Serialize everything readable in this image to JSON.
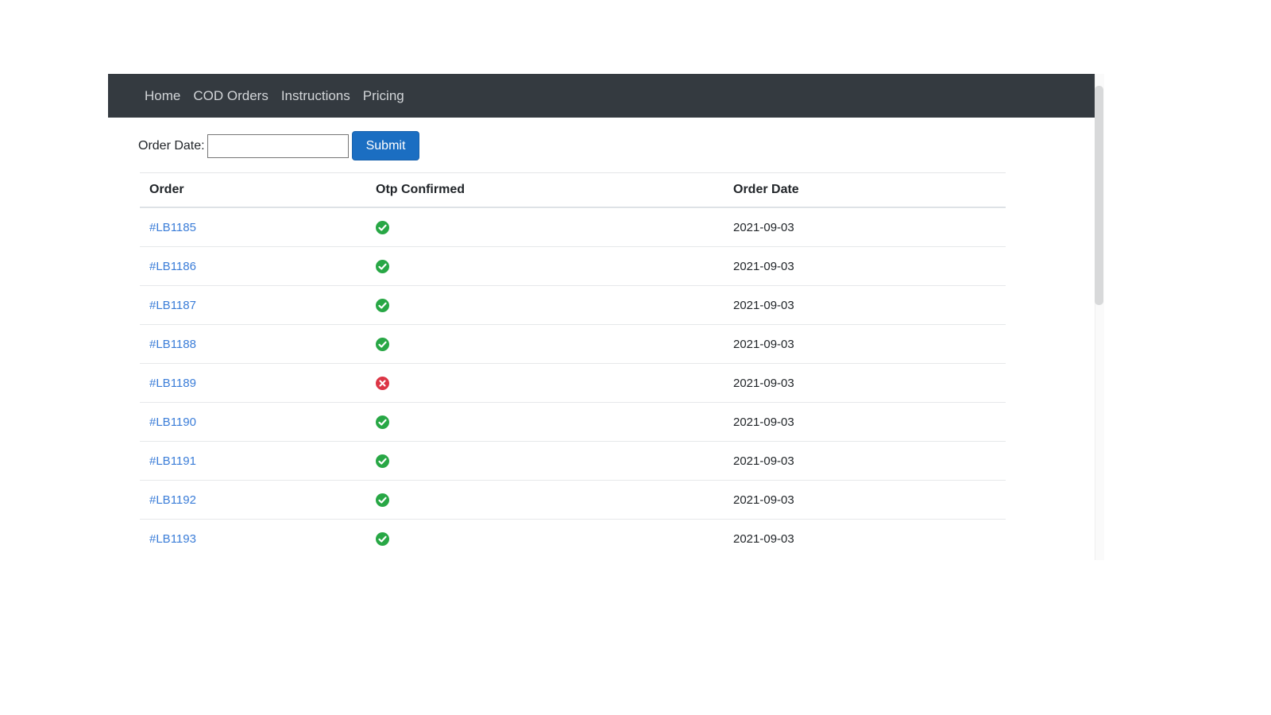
{
  "navbar": {
    "background_color": "#343a40",
    "items": [
      {
        "label": "Home",
        "name": "nav-link-home"
      },
      {
        "label": "COD Orders",
        "name": "nav-link-cod-orders"
      },
      {
        "label": "Instructions",
        "name": "nav-link-instructions"
      },
      {
        "label": "Pricing",
        "name": "nav-link-pricing"
      }
    ]
  },
  "form": {
    "order_date_label": "Order Date:",
    "order_date_value": "",
    "order_date_placeholder": "",
    "submit_label": "Submit",
    "submit_color": "#1b6ec2"
  },
  "table": {
    "columns": [
      "Order",
      "Otp Confirmed",
      "Order Date"
    ],
    "status_colors": {
      "confirmed": "#28a745",
      "not_confirmed": "#dc3545"
    },
    "rows": [
      {
        "order": "#LB1185",
        "otp_confirmed": true,
        "otp_icon": "check-circle-icon",
        "order_date": "2021-09-03"
      },
      {
        "order": "#LB1186",
        "otp_confirmed": true,
        "otp_icon": "check-circle-icon",
        "order_date": "2021-09-03"
      },
      {
        "order": "#LB1187",
        "otp_confirmed": true,
        "otp_icon": "check-circle-icon",
        "order_date": "2021-09-03"
      },
      {
        "order": "#LB1188",
        "otp_confirmed": true,
        "otp_icon": "check-circle-icon",
        "order_date": "2021-09-03"
      },
      {
        "order": "#LB1189",
        "otp_confirmed": false,
        "otp_icon": "x-circle-icon",
        "order_date": "2021-09-03"
      },
      {
        "order": "#LB1190",
        "otp_confirmed": true,
        "otp_icon": "check-circle-icon",
        "order_date": "2021-09-03"
      },
      {
        "order": "#LB1191",
        "otp_confirmed": true,
        "otp_icon": "check-circle-icon",
        "order_date": "2021-09-03"
      },
      {
        "order": "#LB1192",
        "otp_confirmed": true,
        "otp_icon": "check-circle-icon",
        "order_date": "2021-09-03"
      },
      {
        "order": "#LB1193",
        "otp_confirmed": true,
        "otp_icon": "check-circle-icon",
        "order_date": "2021-09-03"
      }
    ]
  }
}
